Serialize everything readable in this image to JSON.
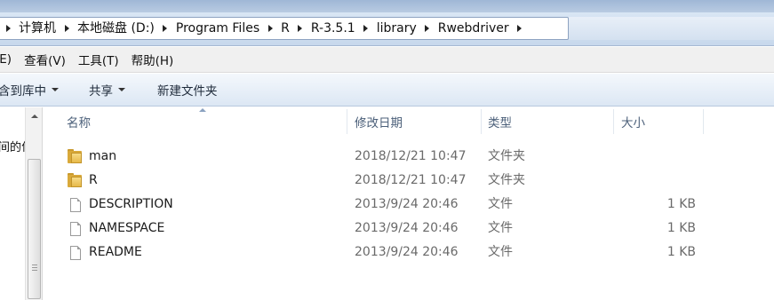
{
  "breadcrumb": {
    "items": [
      "计算机",
      "本地磁盘 (D:)",
      "Program Files",
      "R",
      "R-3.5.1",
      "library",
      "Rwebdriver"
    ]
  },
  "menubar": {
    "items": [
      "(E)",
      "查看(V)",
      "工具(T)",
      "帮助(H)"
    ]
  },
  "commandbar": {
    "include_library": "含到库中",
    "share": "共享",
    "new_folder": "新建文件夹"
  },
  "navpane": {
    "partial_text": "间的位"
  },
  "columns": {
    "name": "名称",
    "date": "修改日期",
    "type": "类型",
    "size": "大小"
  },
  "files": [
    {
      "name": "man",
      "date": "2018/12/21 10:47",
      "type": "文件夹",
      "size": "",
      "icon": "folder-icon"
    },
    {
      "name": "R",
      "date": "2018/12/21 10:47",
      "type": "文件夹",
      "size": "",
      "icon": "folder-icon"
    },
    {
      "name": "DESCRIPTION",
      "date": "2013/9/24 20:46",
      "type": "文件",
      "size": "1 KB",
      "icon": "file-icon"
    },
    {
      "name": "NAMESPACE",
      "date": "2013/9/24 20:46",
      "type": "文件",
      "size": "1 KB",
      "icon": "file-icon"
    },
    {
      "name": "README",
      "date": "2013/9/24 20:46",
      "type": "文件",
      "size": "1 KB",
      "icon": "file-icon"
    }
  ],
  "colors": {
    "header_text": "#4c607a",
    "folder": "#e7b94a"
  }
}
